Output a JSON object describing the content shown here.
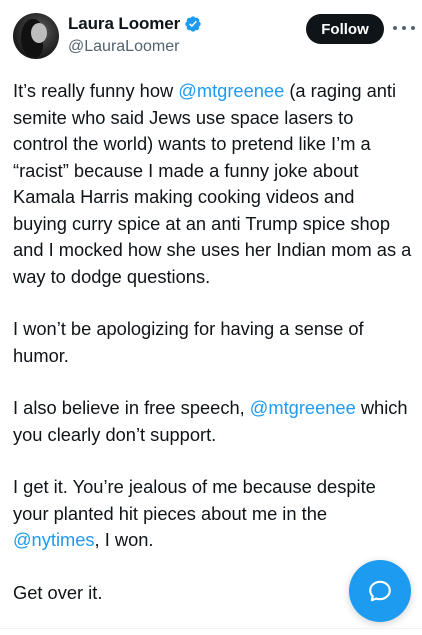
{
  "author": {
    "display_name": "Laura Loomer",
    "handle": "@LauraLoomer",
    "verified_icon": "verified-badge-icon"
  },
  "actions": {
    "follow_label": "Follow",
    "more_icon": "more-horizontal-icon",
    "reply_icon": "compose-reply-icon"
  },
  "colors": {
    "accent": "#1d9bf0",
    "text": "#0f1419",
    "secondary": "#536471"
  },
  "tweet": {
    "p1": {
      "t1": "It’s really funny how ",
      "m1": "@mtgreenee",
      "t2": " (a raging anti semite who said Jews use space lasers to control the world) wants to pretend like I’m a “racist” because I made a funny joke about Kamala Harris making cooking videos and buying curry spice at an anti Trump spice shop and I mocked how she uses her Indian mom as a way to dodge questions."
    },
    "p2": "I won’t be apologizing for having a sense of humor.",
    "p3": {
      "t1": "I also believe in free speech, ",
      "m1": "@mtgreenee",
      "t2": " which you clearly don’t support."
    },
    "p4": {
      "t1": "I get it. You’re jealous of me because despite your planted hit pieces about me in the ",
      "m1": "@nytimes",
      "t2": ", I won."
    },
    "p5": "Get over it."
  }
}
